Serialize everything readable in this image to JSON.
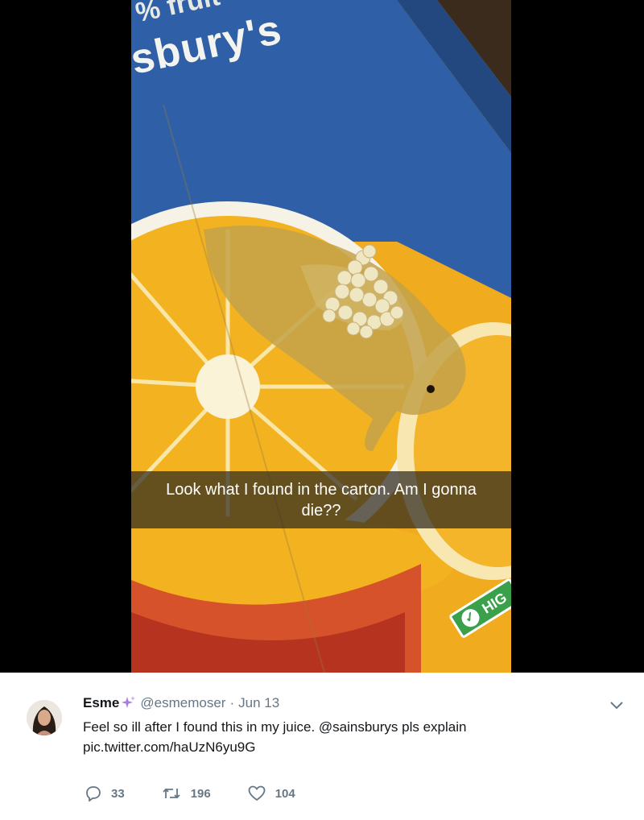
{
  "photo": {
    "brand_partial": "sbury's",
    "top_partial": "% fruit",
    "badge_text": "HIG",
    "caption": "Look what I found in the carton. Am I gonna die??"
  },
  "tweet": {
    "display_name": "Esme",
    "handle": "@esmemoser",
    "separator": "·",
    "date": "Jun 13",
    "text": "Feel so ill after I found this in my juice. @sainsburys pls explain",
    "link": "pic.twitter.com/haUzN6yu9G",
    "reply_count": "33",
    "retweet_count": "196",
    "like_count": "104"
  },
  "icons": {
    "sparkle": "sparkles-icon",
    "more": "chevron-down-icon",
    "reply": "reply-icon",
    "retweet": "retweet-icon",
    "like": "heart-icon"
  },
  "colors": {
    "carton_blue": "#2f5fa6",
    "orange": "#e9a318",
    "text_primary": "#14171a",
    "text_secondary": "#657786",
    "sparkle": "#a77de0"
  }
}
